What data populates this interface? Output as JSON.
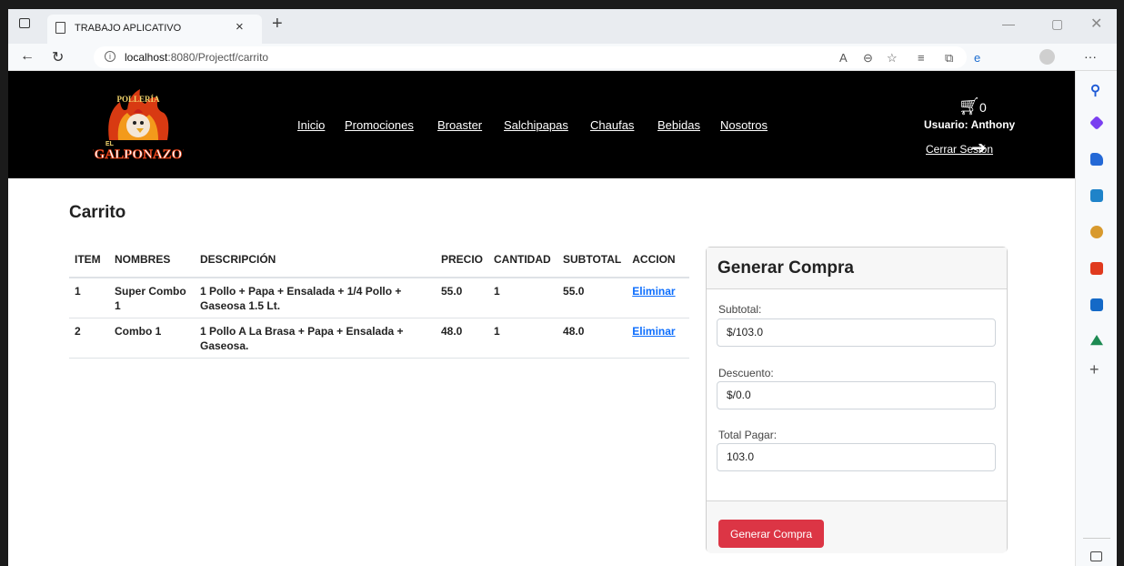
{
  "browser": {
    "tab_title": "TRABAJO APLICATIVO",
    "tab_close": "×",
    "new_tab": "+",
    "url_host": "localhost",
    "url_rest": ":8080/Projectf/carrito"
  },
  "header": {
    "logo_text_top": "POLLERÍA",
    "logo_text_el": "EL",
    "logo_text_main": "\"GALPONAZO\"",
    "nav": [
      "Inicio",
      "Promociones",
      "Broaster",
      "Salchipapas",
      "Chaufas",
      "Bebidas",
      "Nosotros"
    ],
    "cart_count": "0",
    "user_label": "Usuario: Anthony",
    "logout_label": "Cerrar Sesión"
  },
  "main": {
    "title": "Carrito",
    "table": {
      "headers": [
        "ITEM",
        "NOMBRES",
        "DESCRIPCIÓN",
        "PRECIO",
        "CANTIDAD",
        "SUBTOTAL",
        "ACCION"
      ],
      "rows": [
        {
          "item": "1",
          "nombre": "Super Combo 1",
          "descripcion": "1 Pollo + Papa + Ensalada + 1/4 Pollo + Gaseosa 1.5 Lt.",
          "precio": "55.0",
          "cantidad": "1",
          "subtotal": "55.0",
          "accion": "Eliminar"
        },
        {
          "item": "2",
          "nombre": "Combo 1",
          "descripcion": "1 Pollo A La Brasa + Papa + Ensalada + Gaseosa.",
          "precio": "48.0",
          "cantidad": "1",
          "subtotal": "48.0",
          "accion": "Eliminar"
        }
      ]
    }
  },
  "summary": {
    "title": "Generar Compra",
    "subtotal_label": "Subtotal:",
    "subtotal_value": "$/103.0",
    "descuento_label": "Descuento:",
    "descuento_value": "$/0.0",
    "total_label": "Total Pagar:",
    "total_value": "103.0",
    "button_label": "Generar Compra"
  },
  "colors": {
    "header_bg": "#000000",
    "link": "#0d6efd",
    "button_danger": "#dc3545"
  }
}
